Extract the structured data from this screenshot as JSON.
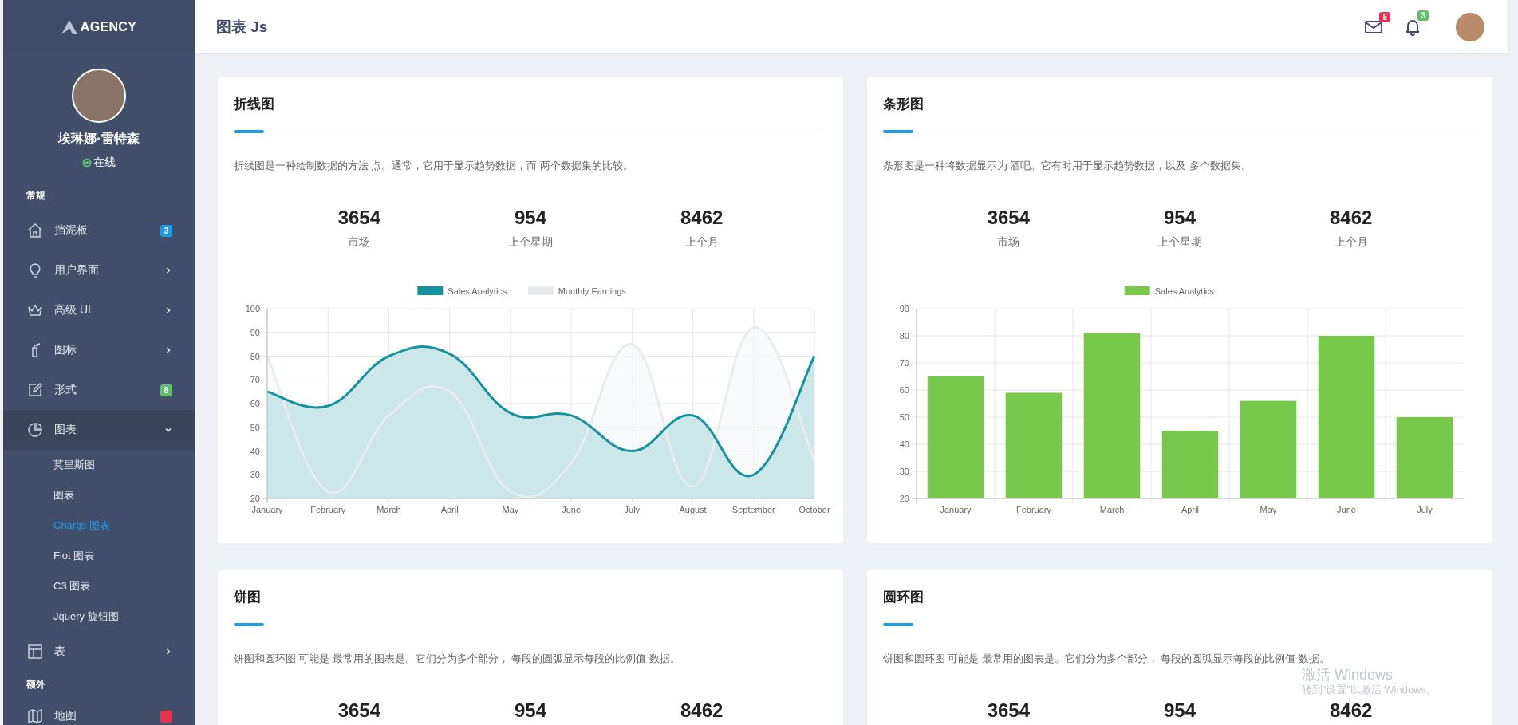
{
  "sidebar": {
    "logo": "AGENCY",
    "profile": {
      "name": "埃琳娜·雷特森",
      "status": "在线"
    },
    "sections": [
      {
        "title": "常规",
        "items": [
          {
            "label": "挡泥板",
            "badge": {
              "text": "3",
              "color": "#1b9bea"
            },
            "selected": false
          },
          {
            "label": "用户界面",
            "expanded": false,
            "selected": false
          },
          {
            "label": "高级 UI",
            "expanded": false,
            "selected": false
          },
          {
            "label": "图标",
            "expanded": false,
            "selected": false
          },
          {
            "label": "形式",
            "badge": {
              "text": "8",
              "color": "#5ec26a"
            },
            "selected": false
          },
          {
            "label": "图表",
            "expanded": true,
            "selected": true,
            "children": [
              {
                "label": "莫里斯图",
                "selected": false
              },
              {
                "label": "图表",
                "selected": false
              },
              {
                "label": "Chartjs 图表",
                "selected": true
              },
              {
                "label": "Flot 图表",
                "selected": false
              },
              {
                "label": "C3 图表",
                "selected": false
              },
              {
                "label": "Jquery 旋钮图",
                "selected": false
              }
            ]
          },
          {
            "label": "表",
            "expanded": false,
            "selected": false
          }
        ]
      },
      {
        "title": "额外",
        "items": [
          {
            "label": "地图",
            "badge": {
              "color": "#e8334f"
            },
            "selected": false
          }
        ]
      }
    ]
  },
  "header": {
    "title": "图表 Js",
    "mail_badge": {
      "text": "5",
      "color": "#e8334f"
    },
    "bell_badge": {
      "text": "3",
      "color": "#5ec26a"
    }
  },
  "cards": [
    {
      "title": "折线图",
      "description": "折线图是一种绘制数据的方法 点。通常，它用于显示趋势数据，而 两个数据集的比较。",
      "stats": [
        {
          "value": "3654",
          "label": "市场"
        },
        {
          "value": "954",
          "label": "上个星期"
        },
        {
          "value": "8462",
          "label": "上个月"
        }
      ],
      "chart_data": {
        "type": "area",
        "categories": [
          "January",
          "February",
          "March",
          "April",
          "May",
          "June",
          "July",
          "August",
          "September",
          "October"
        ],
        "series": [
          {
            "name": "Sales Analytics",
            "color": "#12939f",
            "values": [
              65,
              59,
              80,
              81,
              56,
              55,
              40,
              55,
              30,
              80
            ]
          },
          {
            "name": "Monthly Earnings",
            "color": "#e8ecef",
            "values": [
              80,
              23,
              55,
              65,
              23,
              35,
              85,
              25,
              92,
              36
            ]
          }
        ],
        "ylim": [
          20,
          100
        ],
        "yticks": [
          20,
          30,
          40,
          50,
          60,
          70,
          80,
          90,
          100
        ],
        "grid": true,
        "legend": "top"
      }
    },
    {
      "title": "条形图",
      "description": "条形图是一种将数据显示为 酒吧。它有时用于显示趋势数据，以及 多个数据集。",
      "stats": [
        {
          "value": "3654",
          "label": "市场"
        },
        {
          "value": "954",
          "label": "上个星期"
        },
        {
          "value": "8462",
          "label": "上个月"
        }
      ],
      "chart_data": {
        "type": "bar",
        "categories": [
          "January",
          "February",
          "March",
          "April",
          "May",
          "June",
          "July"
        ],
        "series": [
          {
            "name": "Sales Analytics",
            "color": "#78c84b",
            "values": [
              65,
              59,
              81,
              45,
              56,
              80,
              50
            ]
          }
        ],
        "ylim": [
          20,
          90
        ],
        "yticks": [
          20,
          30,
          40,
          50,
          60,
          70,
          80,
          90
        ],
        "grid": true,
        "legend": "top"
      }
    },
    {
      "title": "饼图",
      "description": "饼图和圆环图 可能是 最常用的图表是。它们分为多个部分， 每段的圆弧显示每段的比例值 数据。",
      "stats": [
        {
          "value": "3654"
        },
        {
          "value": "954"
        },
        {
          "value": "8462"
        }
      ]
    },
    {
      "title": "圆环图",
      "description": "饼图和圆环图 可能是 最常用的图表是。它们分为多个部分， 每段的圆弧显示每段的比例值 数据。",
      "stats": [
        {
          "value": "3654"
        },
        {
          "value": "954"
        },
        {
          "value": "8462"
        }
      ]
    }
  ],
  "os_notice": {
    "title": "激活 Windows",
    "subtitle": "转到“设置”以激活 Windows。"
  }
}
